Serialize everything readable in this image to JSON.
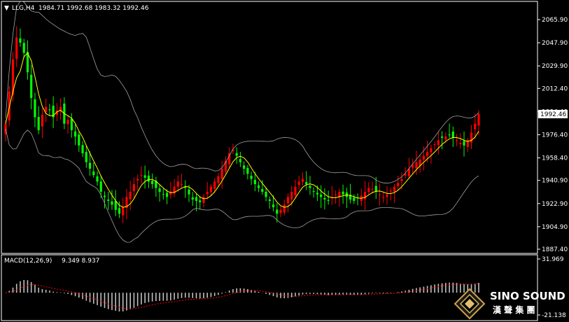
{
  "header": {
    "symbol": "LLG,H4",
    "ohlc": "1984.71 1992.68 1983.32 1992.46"
  },
  "macd_header": {
    "label": "MACD(12,26,9)",
    "values": "9.349 8.937"
  },
  "logo": {
    "name": "SINO SOUND",
    "cn": "漢 聲 集 團"
  },
  "colors": {
    "background": "#000000",
    "bull": "#ff0000",
    "bear": "#00ff00",
    "ma": "#ffff00",
    "bands": "#a0a0a0",
    "macd_hist": "#c0c0c0",
    "macd_signal": "#ff0000",
    "current_price_box": "#ffffff"
  },
  "chart_data": [
    {
      "type": "candlestick",
      "symbol": "LLG",
      "timeframe": "H4",
      "price_ticks": [
        "2065.90",
        "2047.90",
        "2029.90",
        "2012.40",
        "1994.40",
        "1976.40",
        "1958.40",
        "1940.90",
        "1922.90",
        "1904.90",
        "1887.40"
      ],
      "current_price": "1992.46",
      "ylim": [
        1887.4,
        2065.9
      ],
      "overlays": [
        "moving-average",
        "bollinger-bands"
      ],
      "grid": false,
      "close": [
        1985,
        2010,
        2035,
        2052,
        2048,
        2040,
        2025,
        2005,
        1990,
        1980,
        1992,
        1998,
        1996,
        1990,
        1995,
        1998,
        1985,
        1988,
        1980,
        1975,
        1968,
        1962,
        1955,
        1950,
        1945,
        1940,
        1932,
        1928,
        1925,
        1922,
        1918,
        1915,
        1920,
        1928,
        1932,
        1938,
        1942,
        1945,
        1943,
        1940,
        1938,
        1935,
        1932,
        1930,
        1928,
        1932,
        1936,
        1940,
        1938,
        1935,
        1930,
        1926,
        1925,
        1924,
        1928,
        1932,
        1936,
        1940,
        1944,
        1950,
        1956,
        1962,
        1965,
        1960,
        1955,
        1950,
        1946,
        1942,
        1938,
        1935,
        1932,
        1928,
        1925,
        1920,
        1915,
        1918,
        1922,
        1928,
        1932,
        1936,
        1940,
        1942,
        1938,
        1935,
        1932,
        1930,
        1928,
        1926,
        1925,
        1928,
        1930,
        1932,
        1930,
        1928,
        1926,
        1925,
        1927,
        1929,
        1932,
        1935,
        1934,
        1932,
        1930,
        1928,
        1930,
        1933,
        1936,
        1939,
        1942,
        1946,
        1950,
        1953,
        1955,
        1957,
        1960,
        1963,
        1966,
        1969,
        1972,
        1974,
        1975,
        1976,
        1974,
        1972,
        1970,
        1968,
        1972,
        1978,
        1985,
        1992.46
      ]
    },
    {
      "type": "macd",
      "params": "12,26,9",
      "value_ticks": [
        "31.969",
        "-21.138"
      ],
      "ylim": [
        -21.138,
        31.969
      ],
      "macd": 9.349,
      "signal": 8.937
    }
  ]
}
